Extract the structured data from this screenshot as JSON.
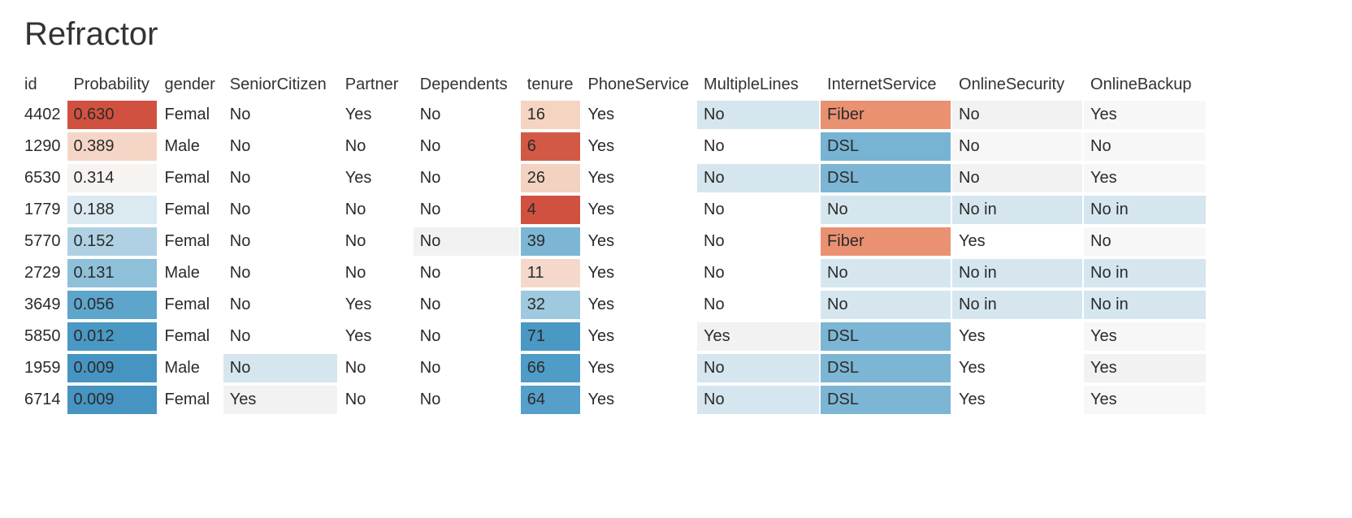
{
  "title": "Refractor",
  "columns": [
    "id",
    "Probability",
    "gender",
    "SeniorCitizen",
    "Partner",
    "Dependents",
    "tenure",
    "PhoneService",
    "MultipleLines",
    "InternetService",
    "OnlineSecurity",
    "OnlineBackup"
  ],
  "rows": [
    {
      "id": "4402",
      "Probability": "0.630",
      "gender": "Femal",
      "SeniorCitizen": "No",
      "Partner": "Yes",
      "Dependents": "No",
      "tenure": "16",
      "PhoneService": "Yes",
      "MultipleLines": "No",
      "InternetService": "Fiber",
      "OnlineSecurity": "No",
      "OnlineBackup": "Yes"
    },
    {
      "id": "1290",
      "Probability": "0.389",
      "gender": "Male",
      "SeniorCitizen": "No",
      "Partner": "No",
      "Dependents": "No",
      "tenure": "6",
      "PhoneService": "Yes",
      "MultipleLines": "No",
      "InternetService": "DSL",
      "OnlineSecurity": "No",
      "OnlineBackup": "No"
    },
    {
      "id": "6530",
      "Probability": "0.314",
      "gender": "Femal",
      "SeniorCitizen": "No",
      "Partner": "Yes",
      "Dependents": "No",
      "tenure": "26",
      "PhoneService": "Yes",
      "MultipleLines": "No",
      "InternetService": "DSL",
      "OnlineSecurity": "No",
      "OnlineBackup": "Yes"
    },
    {
      "id": "1779",
      "Probability": "0.188",
      "gender": "Femal",
      "SeniorCitizen": "No",
      "Partner": "No",
      "Dependents": "No",
      "tenure": "4",
      "PhoneService": "Yes",
      "MultipleLines": "No",
      "InternetService": "No",
      "OnlineSecurity": "No in",
      "OnlineBackup": "No in"
    },
    {
      "id": "5770",
      "Probability": "0.152",
      "gender": "Femal",
      "SeniorCitizen": "No",
      "Partner": "No",
      "Dependents": "No",
      "tenure": "39",
      "PhoneService": "Yes",
      "MultipleLines": "No",
      "InternetService": "Fiber",
      "OnlineSecurity": "Yes",
      "OnlineBackup": "No"
    },
    {
      "id": "2729",
      "Probability": "0.131",
      "gender": "Male",
      "SeniorCitizen": "No",
      "Partner": "No",
      "Dependents": "No",
      "tenure": "11",
      "PhoneService": "Yes",
      "MultipleLines": "No",
      "InternetService": "No",
      "OnlineSecurity": "No in",
      "OnlineBackup": "No in"
    },
    {
      "id": "3649",
      "Probability": "0.056",
      "gender": "Femal",
      "SeniorCitizen": "No",
      "Partner": "Yes",
      "Dependents": "No",
      "tenure": "32",
      "PhoneService": "Yes",
      "MultipleLines": "No",
      "InternetService": "No",
      "OnlineSecurity": "No in",
      "OnlineBackup": "No in"
    },
    {
      "id": "5850",
      "Probability": "0.012",
      "gender": "Femal",
      "SeniorCitizen": "No",
      "Partner": "Yes",
      "Dependents": "No",
      "tenure": "71",
      "PhoneService": "Yes",
      "MultipleLines": "Yes",
      "InternetService": "DSL",
      "OnlineSecurity": "Yes",
      "OnlineBackup": "Yes"
    },
    {
      "id": "1959",
      "Probability": "0.009",
      "gender": "Male",
      "SeniorCitizen": "No",
      "Partner": "No",
      "Dependents": "No",
      "tenure": "66",
      "PhoneService": "Yes",
      "MultipleLines": "No",
      "InternetService": "DSL",
      "OnlineSecurity": "Yes",
      "OnlineBackup": "Yes"
    },
    {
      "id": "6714",
      "Probability": "0.009",
      "gender": "Femal",
      "SeniorCitizen": "Yes",
      "Partner": "No",
      "Dependents": "No",
      "tenure": "64",
      "PhoneService": "Yes",
      "MultipleLines": "No",
      "InternetService": "DSL",
      "OnlineSecurity": "Yes",
      "OnlineBackup": "Yes"
    }
  ],
  "cell_colors": [
    {
      "Probability": "#d15140",
      "tenure": "#f6d4c2",
      "MultipleLines": "#d5e6ef",
      "InternetService": "#ea9172",
      "OnlineSecurity": "#f2f2f2",
      "OnlineBackup": "#f7f7f7"
    },
    {
      "Probability": "#f5d6c6",
      "tenure": "#d35947",
      "InternetService": "#77b3d3",
      "OnlineSecurity": "#f7f7f7",
      "OnlineBackup": "#f7f7f7"
    },
    {
      "Probability": "#f6f3f1",
      "tenure": "#f3d2c1",
      "MultipleLines": "#d5e6ef",
      "InternetService": "#7cb6d4",
      "OnlineSecurity": "#f2f2f2",
      "OnlineBackup": "#f7f7f7"
    },
    {
      "Probability": "#dbe9f1",
      "tenure": "#d15140",
      "InternetService": "#d5e6ef",
      "OnlineSecurity": "#d5e6ef",
      "OnlineBackup": "#d5e6ef"
    },
    {
      "Probability": "#afd1e3",
      "Dependents": "#f2f2f2",
      "tenure": "#7cb6d4",
      "InternetService": "#ea9172",
      "OnlineBackup": "#f7f7f7"
    },
    {
      "Probability": "#8fc0da",
      "tenure": "#f4d9cb",
      "InternetService": "#d5e6ef",
      "OnlineSecurity": "#d5e6ef",
      "OnlineBackup": "#d5e6ef"
    },
    {
      "Probability": "#5ea5cc",
      "tenure": "#9fc9df",
      "InternetService": "#d5e6ef",
      "OnlineSecurity": "#d5e6ef",
      "OnlineBackup": "#d5e6ef"
    },
    {
      "Probability": "#4a98c4",
      "tenure": "#4a98c4",
      "MultipleLines": "#f2f2f2",
      "InternetService": "#7cb6d4",
      "OnlineBackup": "#f7f7f7"
    },
    {
      "Probability": "#4694c2",
      "SeniorCitizen": "#d5e6ef",
      "tenure": "#4f9cc7",
      "MultipleLines": "#d5e6ef",
      "InternetService": "#7cb6d4",
      "OnlineBackup": "#f2f2f2"
    },
    {
      "Probability": "#4694c2",
      "SeniorCitizen": "#f2f2f2",
      "tenure": "#559fc9",
      "MultipleLines": "#d5e6ef",
      "InternetService": "#7cb6d4",
      "OnlineBackup": "#f7f7f7"
    }
  ],
  "chart_data": {
    "type": "table",
    "title": "Refractor",
    "columns": [
      "id",
      "Probability",
      "gender",
      "SeniorCitizen",
      "Partner",
      "Dependents",
      "tenure",
      "PhoneService",
      "MultipleLines",
      "InternetService",
      "OnlineSecurity",
      "OnlineBackup"
    ],
    "data": [
      [
        4402,
        0.63,
        "Femal",
        "No",
        "Yes",
        "No",
        16,
        "Yes",
        "No",
        "Fiber",
        "No",
        "Yes"
      ],
      [
        1290,
        0.389,
        "Male",
        "No",
        "No",
        "No",
        6,
        "Yes",
        "No",
        "DSL",
        "No",
        "No"
      ],
      [
        6530,
        0.314,
        "Femal",
        "No",
        "Yes",
        "No",
        26,
        "Yes",
        "No",
        "DSL",
        "No",
        "Yes"
      ],
      [
        1779,
        0.188,
        "Femal",
        "No",
        "No",
        "No",
        4,
        "Yes",
        "No",
        "No",
        "No in",
        "No in"
      ],
      [
        5770,
        0.152,
        "Femal",
        "No",
        "No",
        "No",
        39,
        "Yes",
        "No",
        "Fiber",
        "Yes",
        "No"
      ],
      [
        2729,
        0.131,
        "Male",
        "No",
        "No",
        "No",
        11,
        "Yes",
        "No",
        "No",
        "No in",
        "No in"
      ],
      [
        3649,
        0.056,
        "Femal",
        "No",
        "Yes",
        "No",
        32,
        "Yes",
        "No",
        "No",
        "No in",
        "No in"
      ],
      [
        5850,
        0.012,
        "Femal",
        "No",
        "Yes",
        "No",
        71,
        "Yes",
        "Yes",
        "DSL",
        "Yes",
        "Yes"
      ],
      [
        1959,
        0.009,
        "Male",
        "No",
        "No",
        "No",
        66,
        "Yes",
        "No",
        "DSL",
        "Yes",
        "Yes"
      ],
      [
        6714,
        0.009,
        "Femal",
        "Yes",
        "No",
        "No",
        64,
        "Yes",
        "No",
        "DSL",
        "Yes",
        "Yes"
      ]
    ]
  }
}
